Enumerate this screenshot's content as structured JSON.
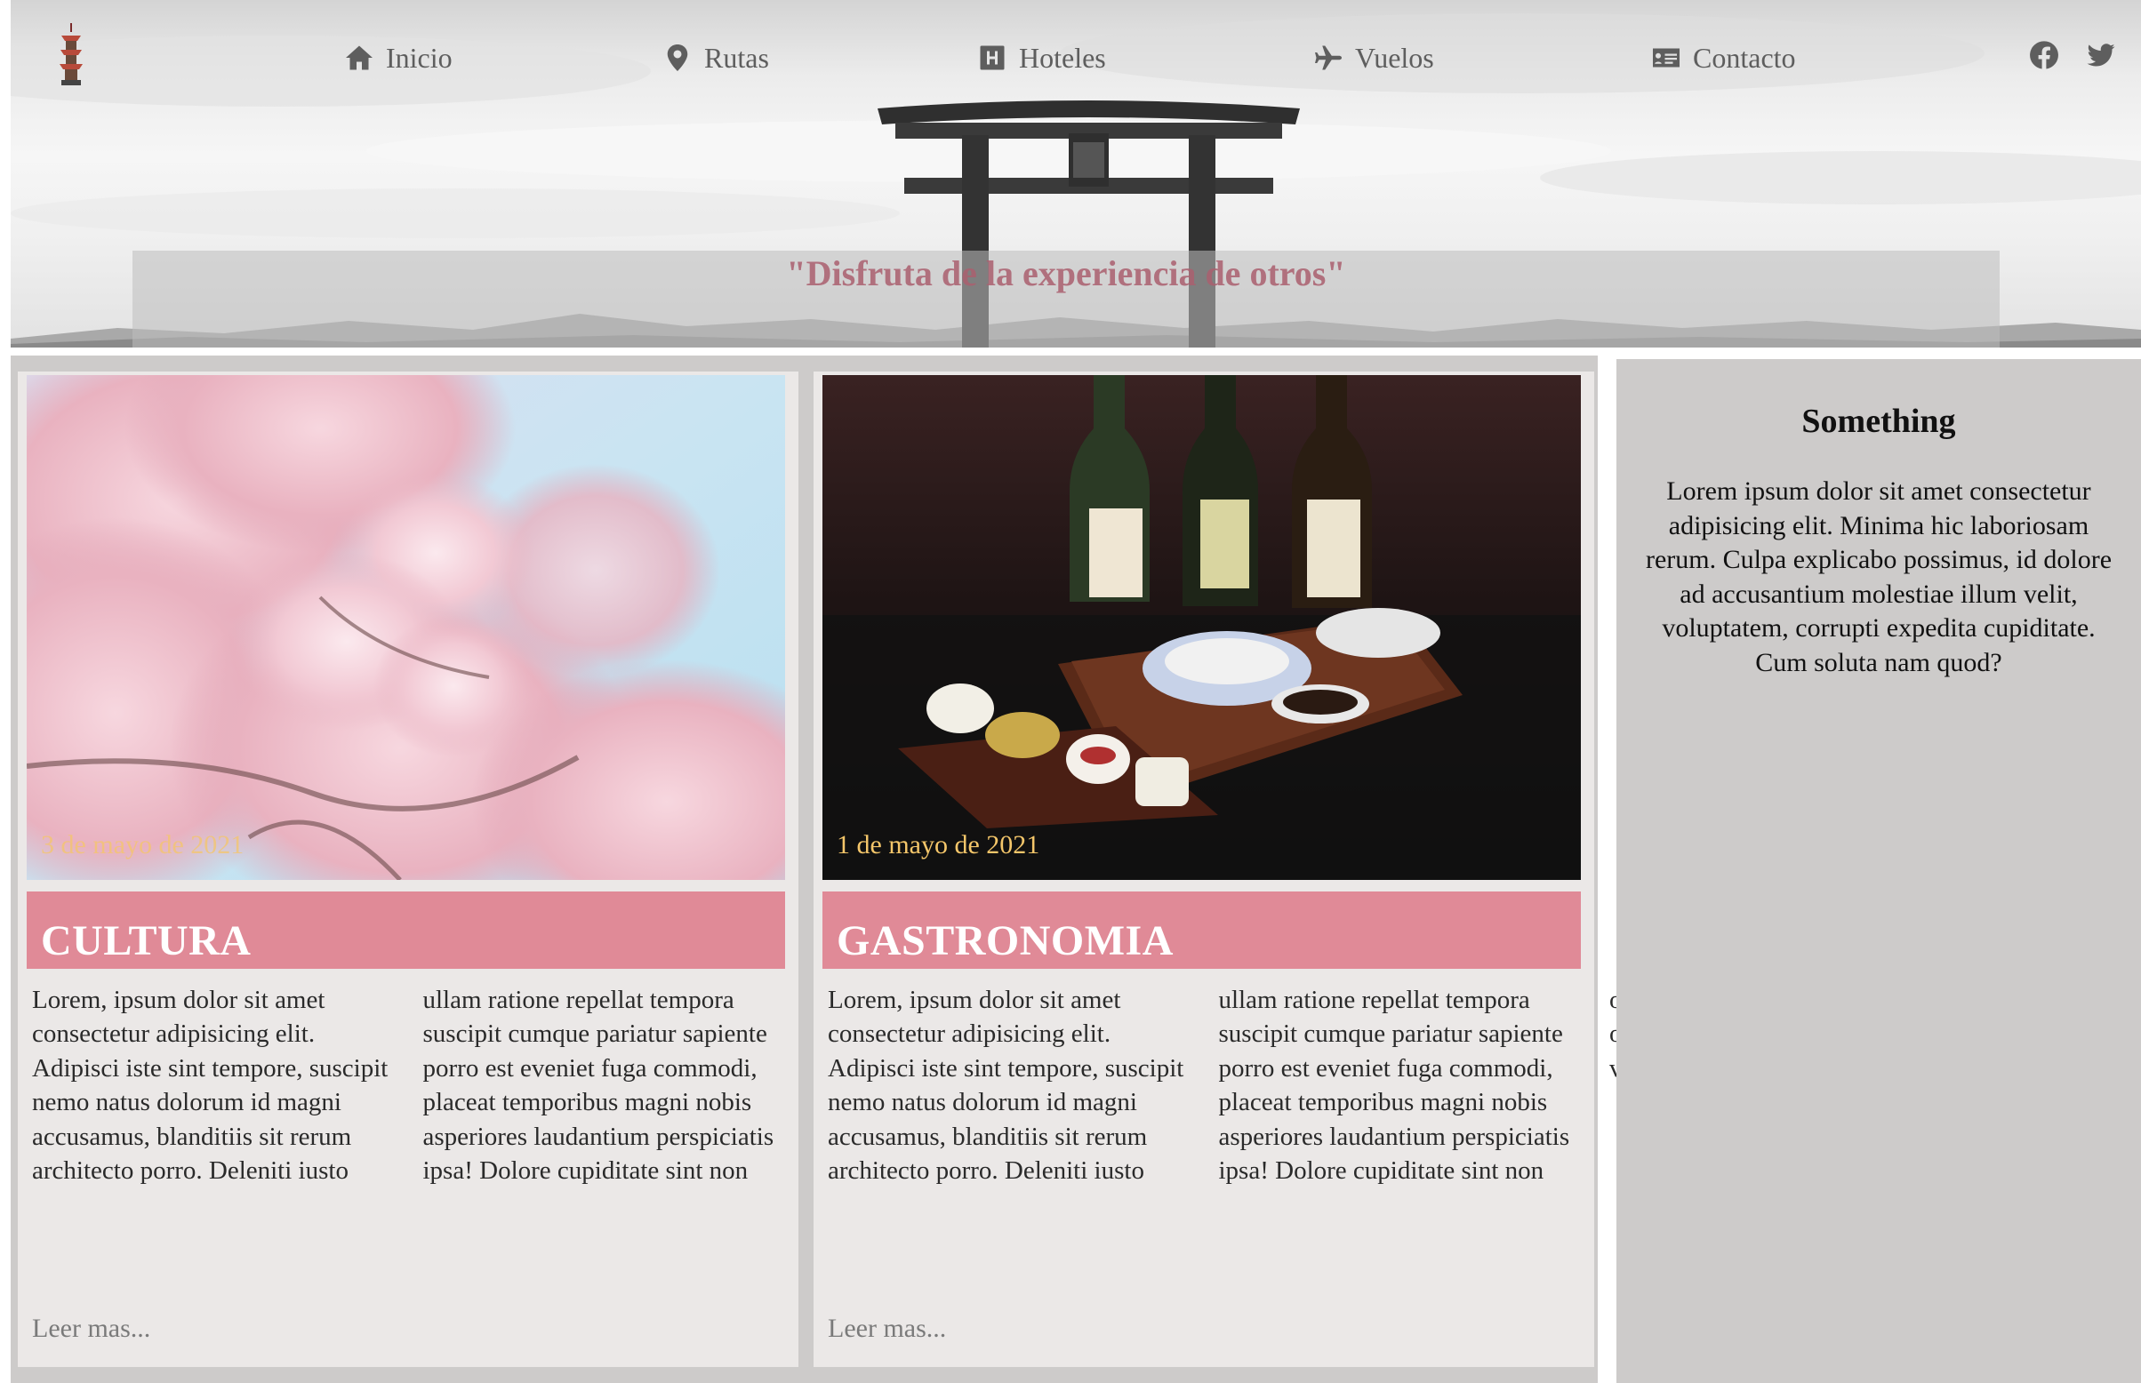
{
  "colors": {
    "accent": "#e08a97",
    "tagline": "#aa5f6e",
    "date": "#f4c66a",
    "card_bg": "#ebe8e7",
    "panel_bg": "#cdcbca",
    "nav_text": "#5e5e5e"
  },
  "header": {
    "logo_icon": "pagoda-icon",
    "nav": [
      {
        "label": "Inicio",
        "icon": "home-icon"
      },
      {
        "label": "Rutas",
        "icon": "map-marker-icon"
      },
      {
        "label": "Hoteles",
        "icon": "hotel-icon"
      },
      {
        "label": "Vuelos",
        "icon": "plane-icon"
      },
      {
        "label": "Contacto",
        "icon": "address-card-icon"
      }
    ],
    "social": [
      "facebook-icon",
      "twitter-icon"
    ],
    "tagline": "\"Disfruta de la experiencia de otros\""
  },
  "cards": [
    {
      "title": "CULTURA",
      "date": "3 de mayo de 2021",
      "image": "cherry-blossom-photo",
      "text": "Lorem, ipsum dolor sit amet consectetur adipisicing elit. Adipisci iste sint tempore, suscipit nemo natus dolorum id magni accusamus, blanditiis sit rerum architecto porro. Deleniti iusto ullam ratione repellat tempora suscipit cumque pariatur sapiente porro est eveniet fuga commodi, placeat temporibus magni nobis asperiores laudantium perspiciatis ipsa! Dolore cupiditate sint non omnis. Modi libero voluptas omnis qui molestiae nisi voluptatem.",
      "more": "Leer mas..."
    },
    {
      "title": "GASTRONOMIA",
      "date": "1 de mayo de 2021",
      "image": "sake-and-food-photo",
      "text": "Lorem, ipsum dolor sit amet consectetur adipisicing elit. Adipisci iste sint tempore, suscipit nemo natus dolorum id magni accusamus, blanditiis sit rerum architecto porro. Deleniti iusto ullam ratione repellat tempora suscipit cumque pariatur sapiente porro est eveniet fuga commodi, placeat temporibus magni nobis asperiores laudantium perspiciatis ipsa! Dolore cupiditate sint non omnis. Modi libero voluptas omnis qui molestiae nisi voluptatem.",
      "more": "Leer mas..."
    }
  ],
  "sidebar": {
    "title": "Something",
    "text": "Lorem ipsum dolor sit amet consectetur adipisicing elit. Minima hic laboriosam rerum. Culpa explicabo possimus, id dolore ad accusantium molestiae illum velit, voluptatem, corrupti expedita cupiditate. Cum soluta nam quod?"
  }
}
